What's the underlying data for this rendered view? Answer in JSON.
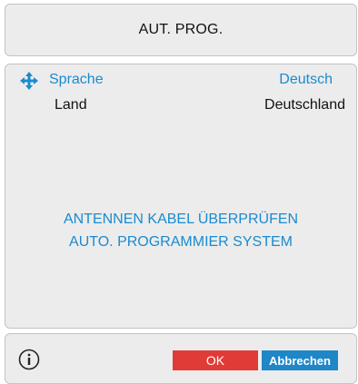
{
  "header": {
    "title": "AUT. PROG."
  },
  "settings": {
    "sprache": {
      "label": "Sprache",
      "value": "Deutsch"
    },
    "land": {
      "label": "Land",
      "value": "Deutschland"
    }
  },
  "messages": {
    "line1": "ANTENNEN KABEL ÜBERPRÜFEN",
    "line2": "AUTO. PROGRAMMIER SYSTEM"
  },
  "footer": {
    "ok_label": "OK",
    "cancel_label": "Abbrechen",
    "info_icon": "info-icon"
  },
  "colors": {
    "accent": "#1a8bd0",
    "ok": "#e03b36",
    "cancel": "#1f86c8",
    "panel": "#ececec"
  }
}
